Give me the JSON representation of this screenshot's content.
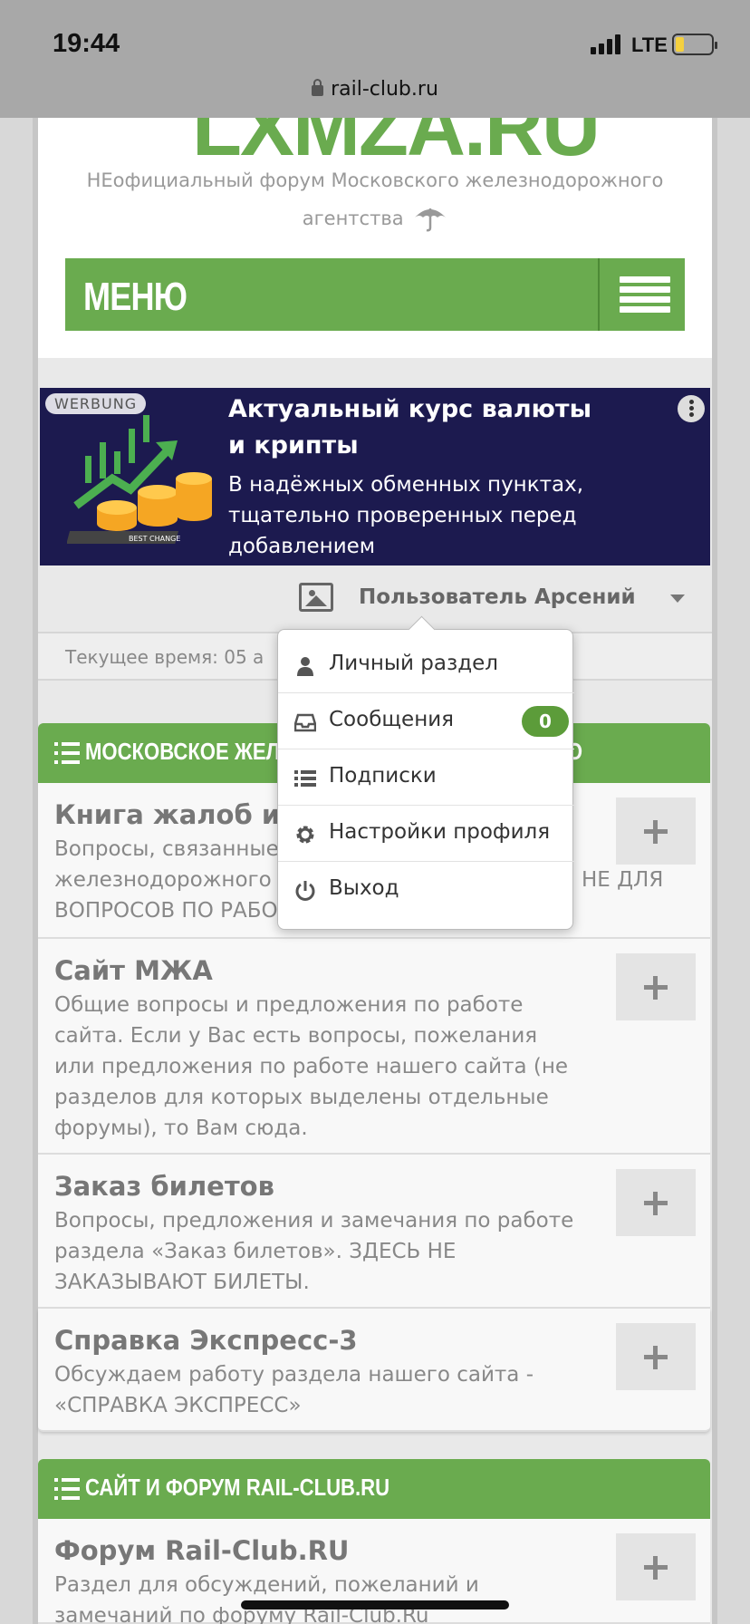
{
  "status": {
    "time": "19:44",
    "network": "LTE"
  },
  "browser": {
    "url": "rail-club.ru"
  },
  "header": {
    "logo_text": "LXMZA.RU",
    "tagline": "НЕофициальный форум Московского железнодорожного агентства",
    "menu_label": "МЕНЮ"
  },
  "ad": {
    "badge": "WERBUNG",
    "title": "Актуальный курс валюты и крипты",
    "text": "В надёжных обменных пунктах, тщательно проверенных перед добавлением",
    "image_label": "BEST CHANGE"
  },
  "user": {
    "name": "Пользователь Арсений"
  },
  "current_time_text": "Текущее время: 05 а",
  "dropdown": {
    "items": [
      {
        "label": "Личный раздел",
        "icon": "user-icon"
      },
      {
        "label": "Сообщения",
        "icon": "inbox-icon",
        "badge": "0"
      },
      {
        "label": "Подписки",
        "icon": "list-icon"
      },
      {
        "label": "Настройки профиля",
        "icon": "gear-icon"
      },
      {
        "label": "Выход",
        "icon": "power-icon"
      }
    ]
  },
  "sections": [
    {
      "title": "МОСКОВСКОЕ ЖЕЛЕЗНОДОРОЖНОЕ АГЕНТСТВО",
      "forums": [
        {
          "title": "Книга жалоб и предложений",
          "desc": "Вопросы, связанные с работой Московского железнодорожного агентства и его филиалов. НЕ ДЛЯ ВОПРОСОВ ПО РАБОТЕ САЙТА."
        },
        {
          "title": "Сайт МЖА",
          "desc": "Общие вопросы и предложения по работе сайта. Если у Вас есть вопросы, пожелания или предложения по работе нашего сайта (не разделов для которых выделены отдельные форумы), то Вам сюда."
        },
        {
          "title": "Заказ билетов",
          "desc": "Вопросы, предложения и замечания по работе раздела «Заказ билетов». ЗДЕСЬ НЕ ЗАКАЗЫВАЮТ БИЛЕТЫ."
        },
        {
          "title": "Справка Экспресс-3",
          "desc": "Обсуждаем работу раздела нашего сайта - «СПРАВКА ЭКСПРЕСС»"
        }
      ]
    },
    {
      "title": "САЙТ И ФОРУМ RAIL-CLUB.RU",
      "forums": [
        {
          "title": "Форум Rail-Club.RU",
          "desc": "Раздел для обсуждений, пожеланий и замечаний по форуму Rail-Club.Ru"
        }
      ]
    }
  ]
}
